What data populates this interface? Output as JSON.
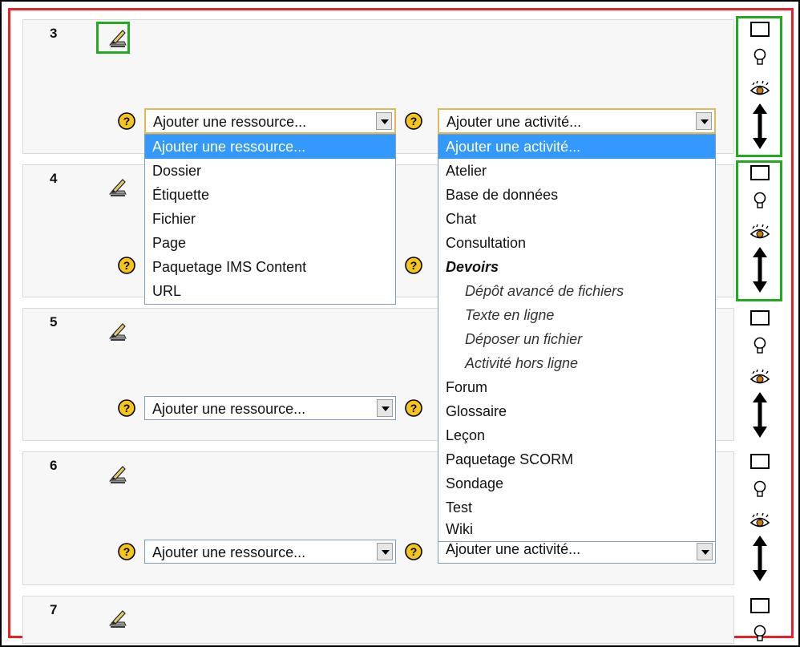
{
  "sections": [
    {
      "number": "3",
      "resource_select": "Ajouter une ressource...",
      "activity_select": "Ajouter une activité..."
    },
    {
      "number": "4"
    },
    {
      "number": "5",
      "resource_select": "Ajouter une ressource..."
    },
    {
      "number": "6",
      "resource_select": "Ajouter une ressource...",
      "activity_select": "Ajouter une activité..."
    },
    {
      "number": "7"
    }
  ],
  "resource_dropdown": {
    "options": [
      "Ajouter une ressource...",
      "Dossier",
      "Étiquette",
      "Fichier",
      "Page",
      "Paquetage IMS Content",
      "URL"
    ]
  },
  "activity_dropdown": {
    "options": [
      "Ajouter une activité...",
      "Atelier",
      "Base de données",
      "Chat",
      "Consultation"
    ],
    "group_label": "Devoirs",
    "group_options": [
      "Dépôt avancé de fichiers",
      "Texte en ligne",
      "Déposer un fichier",
      "Activité hors ligne"
    ],
    "more_options": [
      "Forum",
      "Glossaire",
      "Leçon",
      "Paquetage SCORM",
      "Sondage",
      "Test",
      "Wiki"
    ]
  },
  "icons": {
    "edit": "edit-pencil-icon",
    "help": "help-icon",
    "highlight": "marker-square-icon",
    "bulb": "lightbulb-icon",
    "visibility": "eye-icon",
    "move": "move-arrow-icon"
  },
  "colors": {
    "outer_frame": "#000000",
    "highlight_frame": "#e8202a",
    "green_highlight": "#22aa22",
    "selected_option": "#3399ff",
    "help_icon": "#f5c518"
  }
}
